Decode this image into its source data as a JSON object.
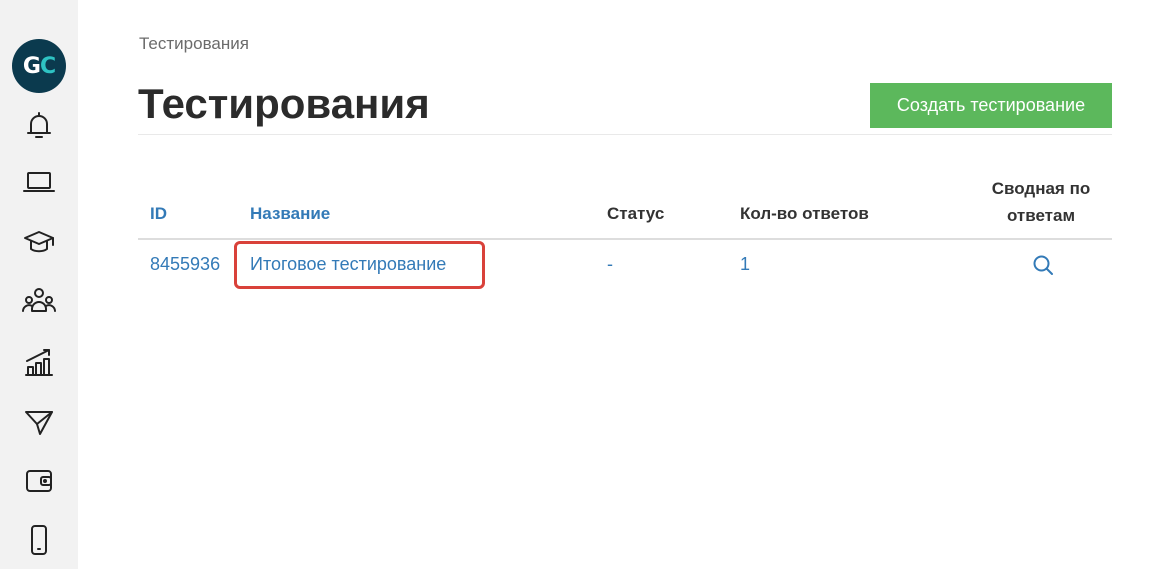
{
  "logo": {
    "g": "G",
    "c": "C"
  },
  "sidebar": {
    "icons": [
      "bell-icon",
      "laptop-icon",
      "graduation-cap-icon",
      "users-icon",
      "chart-growth-icon",
      "paper-plane-icon",
      "wallet-icon",
      "mobile-phone-icon"
    ]
  },
  "breadcrumb": "Тестирования",
  "page_title": "Тестирования",
  "create_button": "Создать тестирование",
  "table": {
    "headers": {
      "id": "ID",
      "name": "Название",
      "status": "Статус",
      "answers": "Кол-во ответов",
      "summary_line1": "Сводная по",
      "summary_line2": "ответам"
    },
    "rows": [
      {
        "id": "8455936",
        "name": "Итоговое тестирование",
        "status": "-",
        "answers": "1"
      }
    ]
  },
  "colors": {
    "accent": "#337ab7",
    "button": "#5cb85c",
    "highlight": "#d9413a",
    "logo_bg": "#0b3a4e"
  }
}
